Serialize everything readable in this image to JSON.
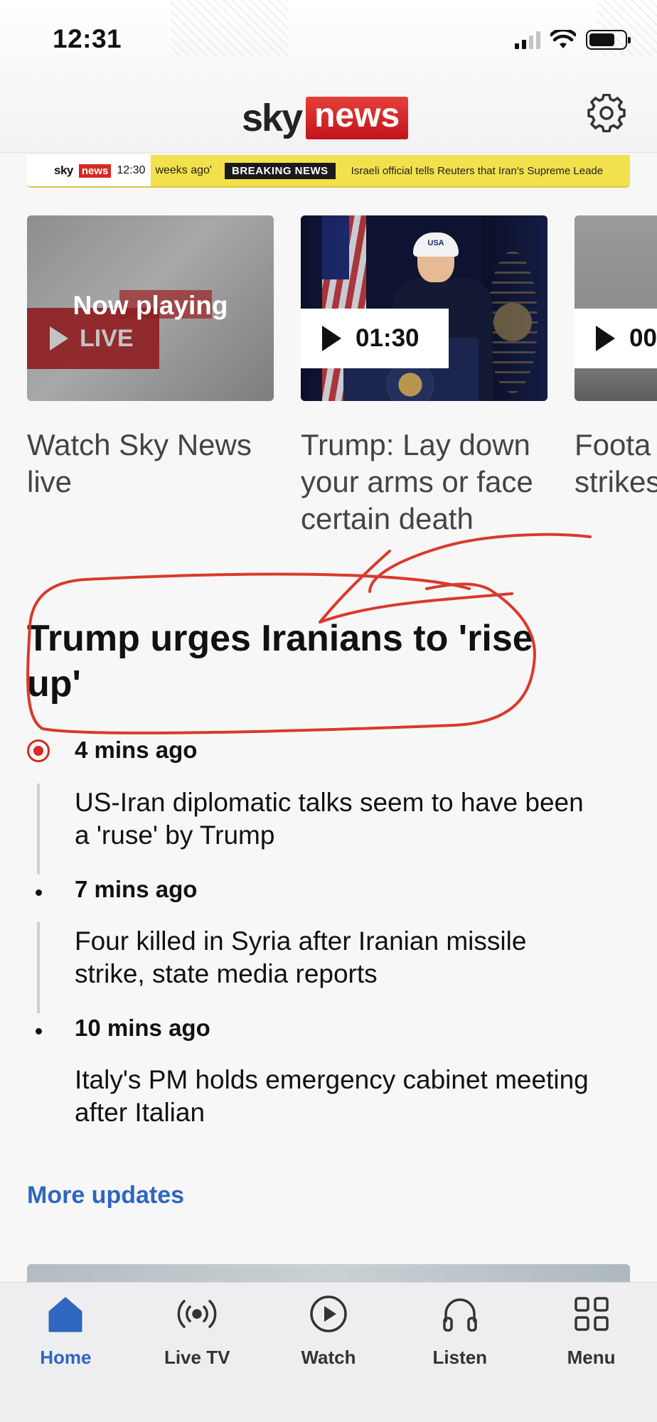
{
  "status_bar": {
    "time": "12:31"
  },
  "header": {
    "logo_sky": "sky",
    "logo_news": "news"
  },
  "ticker": {
    "sky": "sky",
    "news": "news",
    "time": "12:30",
    "previous": "weeks ago'",
    "breaking_label": "BREAKING NEWS",
    "headline": "Israeli official tells Reuters that Iran's Supreme Leade"
  },
  "video_cards": [
    {
      "overlay": "Now playing",
      "badge": "LIVE",
      "caption": "Watch Sky News live"
    },
    {
      "badge": "01:30",
      "cap_text": "USA",
      "caption": "Trump: Lay down your arms or face certain death"
    },
    {
      "badge": "00",
      "caption": "Foota strikes"
    }
  ],
  "headline": "Trump urges Iranians to 'rise up'",
  "timeline": [
    {
      "time": "4 mins ago",
      "text": "US-Iran diplomatic talks seem to have been a 'ruse' by Trump",
      "live": true
    },
    {
      "time": "7 mins ago",
      "text": "Four killed in Syria after Iranian missile strike, state media reports",
      "live": false
    },
    {
      "time": "10 mins ago",
      "text": "Italy's PM holds emergency cabinet meeting after Italian",
      "live": false
    }
  ],
  "more_updates": "More updates",
  "tabs": [
    {
      "label": "Home",
      "icon": "home-icon",
      "active": true
    },
    {
      "label": "Live TV",
      "icon": "broadcast-icon",
      "active": false
    },
    {
      "label": "Watch",
      "icon": "play-circle-icon",
      "active": false
    },
    {
      "label": "Listen",
      "icon": "headphones-icon",
      "active": false
    },
    {
      "label": "Menu",
      "icon": "grid-icon",
      "active": false
    }
  ],
  "colors": {
    "brand_red": "#d42a23",
    "link_blue": "#2e66c0",
    "ticker_yellow": "#f2e14c",
    "annotation_red": "#d93a2b"
  }
}
